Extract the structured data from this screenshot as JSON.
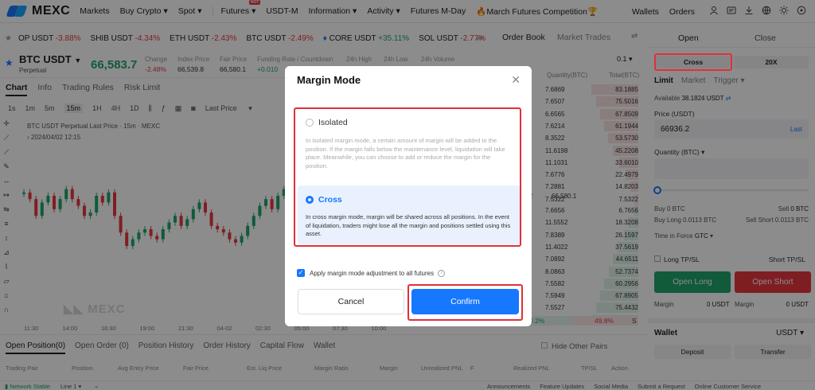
{
  "nav": {
    "logo": "MEXC",
    "items": [
      "Markets",
      "Buy Crypto",
      "Spot",
      "Futures",
      "USDT-M",
      "Information",
      "Activity",
      "Futures M-Day",
      "March Futures Competition"
    ],
    "hot_badge": "HOT",
    "right": [
      "Wallets",
      "Orders"
    ]
  },
  "ticker": [
    {
      "name": "OP USDT",
      "change": "-3.88%"
    },
    {
      "name": "SHIB USDT",
      "change": "-4.34%"
    },
    {
      "name": "ETH USDT",
      "change": "-2.43%"
    },
    {
      "name": "BTC USDT",
      "change": "-2.49%"
    },
    {
      "name": "CORE USDT",
      "change": "+35.11%"
    },
    {
      "name": "SOL USDT",
      "change": "-2.77%"
    }
  ],
  "symbol": {
    "name": "BTC USDT",
    "sub": "Perpetual",
    "price": "66,583.7",
    "change_label": "Change",
    "change_value": "-2.48%",
    "index_label": "Index Price",
    "index_value": "66,539.8",
    "fair_label": "Fair Price",
    "fair_value": "66,580.1",
    "funding_label": "Funding Rate / Countdown",
    "funding_value": "+0.010",
    "high_label": "24h High",
    "low_label": "24h Low",
    "volume_label": "24h Volume"
  },
  "chart_tabs": [
    "Chart",
    "Info",
    "Trading Rules",
    "Risk Limit"
  ],
  "timeframes": [
    "1s",
    "1m",
    "5m",
    "15m",
    "1H",
    "4H",
    "1D"
  ],
  "last_price_label": "Last Price",
  "chart_title": "BTC USDT Perpetual Last Price · 15m · MEXC",
  "chart_date": "2024/04/02 12:15",
  "chart_watermark": "MEXC",
  "chart_xticks": [
    "11:30",
    "14:00",
    "16:30",
    "19:00",
    "21:30",
    "04-02",
    "02:30",
    "05:00",
    "07:30",
    "10:00"
  ],
  "chart_data": {
    "type": "candlestick",
    "title": "",
    "xlabel": "",
    "ylabel": "",
    "x": [
      "11:30",
      "14:00",
      "16:30",
      "19:00",
      "21:30",
      "04-02",
      "02:30"
    ],
    "series": [
      {
        "values": [
          72,
          68,
          58,
          66,
          70,
          62,
          68,
          74,
          68,
          64,
          58,
          60,
          70,
          66,
          72,
          58,
          48,
          40,
          44,
          48,
          50,
          46,
          44,
          50,
          54,
          58,
          52,
          56,
          62,
          66,
          60,
          52,
          50,
          48,
          44,
          42,
          46,
          52,
          58,
          64,
          68,
          62,
          70,
          74,
          80
        ]
      }
    ]
  },
  "order_book": {
    "tabs": [
      "Order Book",
      "Market Trades"
    ],
    "step": "0.1",
    "col_qty": "Quantity(BTC)",
    "col_total": "Total(BTC)",
    "asks": [
      [
        "7.6869",
        "83.1885"
      ],
      [
        "7.6507",
        "75.5016"
      ],
      [
        "6.6565",
        "67.8509"
      ],
      [
        "7.6214",
        "61.1944"
      ],
      [
        "8.3522",
        "53.5730"
      ],
      [
        "11.6198",
        "45.2208"
      ],
      [
        "11.1031",
        "33.6010"
      ],
      [
        "7.6776",
        "22.4979"
      ],
      [
        "7.2881",
        "14.8203"
      ],
      [
        "7.5322",
        "7.5322"
      ]
    ],
    "mid_price": ".7 ↑",
    "mid_fair": "66,580.1",
    "bids": [
      [
        "7.6656",
        "6.7656"
      ],
      [
        "11.5552",
        "18.3208"
      ],
      [
        "7.8389",
        "26.1597"
      ],
      [
        "11.4022",
        "37.5619"
      ],
      [
        "7.0892",
        "44.6511"
      ],
      [
        "8.0863",
        "52.7374"
      ],
      [
        "7.5582",
        "60.2956"
      ],
      [
        "7.5949",
        "67.8905"
      ],
      [
        "7.5527",
        "75.4432"
      ],
      [
        "8.0772",
        "83.5204"
      ]
    ],
    "buy_pct": "0.2%",
    "sell_pct": "49.8%",
    "sell_marker": "S"
  },
  "right_panel": {
    "open_tab": "Open",
    "close_tab": "Close",
    "cross_btn": "Cross",
    "leverage_btn": "20X",
    "order_types": [
      "Limit",
      "Market",
      "Trigger"
    ],
    "available_label": "Available",
    "available_value": "38.1824 USDT",
    "price_label": "Price (USDT)",
    "price_value": "66936.2",
    "last_link": "Last",
    "qty_label": "Quantity (BTC)",
    "buy_label": "Buy 0 BTC",
    "sell_label": "Sell",
    "sell_value": "0 BTC",
    "buy_long": "Buy Long 0.0113 BTC",
    "sell_short": "Sell Short 0.0113 BTC",
    "tif_label": "Time in Force",
    "tif_value": "GTC",
    "long_tpsl": "Long TP/SL",
    "short_tpsl": "Short TP/SL",
    "open_long": "Open Long",
    "open_short": "Open Short",
    "margin_label": "Margin",
    "margin_value": "0 USDT",
    "wallet_label": "Wallet",
    "wallet_currency": "USDT",
    "deposit": "Deposit",
    "transfer": "Transfer"
  },
  "bottom": {
    "tabs": [
      "Open Position(0)",
      "Open Order (0)",
      "Position History",
      "Order History",
      "Capital Flow",
      "Wallet"
    ],
    "hide_pairs": "Hide Other Pairs",
    "columns": [
      "Trading Pair",
      "Position",
      "Avg Entry Price",
      "Fair Price",
      "Est. Liq Price",
      "Margin Ratio",
      "Margin",
      "Unrealized PNL",
      "F",
      "Realized PNL",
      "TP/SL",
      "Action"
    ],
    "status": "Network Stable",
    "line": "Line 1",
    "footer_links": [
      "Announcements",
      "Feature Updates",
      "Social Media",
      "Submit a Request",
      "Online Customer Service"
    ]
  },
  "modal": {
    "title": "Margin Mode",
    "isolated_title": "Isolated",
    "isolated_desc": "In isolated margin mode, a certain amount of margin will be added to the position. If the margin falls below the maintenance level, liquidation will take place. Meanwhile, you can choose to add or reduce the margin for the position.",
    "cross_title": "Cross",
    "cross_desc": "In cross margin mode, margin will be shared across all positions. In the event of liquidation, traders might lose all the margin and positions settled using this asset.",
    "apply_label": "Apply margin mode adjustment to all futures",
    "cancel": "Cancel",
    "confirm": "Confirm"
  },
  "colors": {
    "accent": "#1677ff",
    "green": "#1fa46b",
    "red": "#e8373e",
    "highlight": "#e0303a"
  }
}
